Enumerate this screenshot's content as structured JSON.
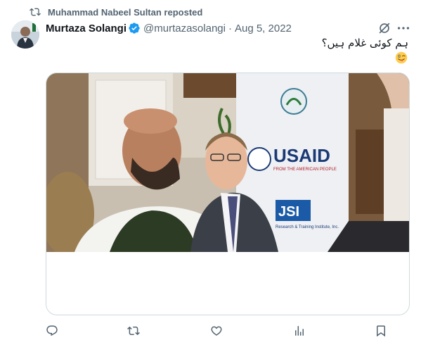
{
  "repost": {
    "text": "Muhammad Nabeel Sultan reposted",
    "icon": "repost-icon"
  },
  "author": {
    "name": "Murtaza Solangi",
    "handle": "@murtazasolangi",
    "separator": "·",
    "date": "Aug 5, 2022",
    "verified": true
  },
  "tweet": {
    "text": "ہم کوئی غلام ہیں؟",
    "emoji": "😜"
  },
  "media": {
    "sign_text": "USAID",
    "sign_subtext": "FROM THE AMERICAN PEOPLE",
    "jsi_text": "JSI",
    "jsi_subtext": "Research & Training Institute, Inc."
  },
  "actions": [
    {
      "name": "reply",
      "icon": "reply-icon"
    },
    {
      "name": "repost",
      "icon": "repost-icon"
    },
    {
      "name": "like",
      "icon": "heart-icon"
    },
    {
      "name": "views",
      "icon": "views-icon"
    },
    {
      "name": "bookmark",
      "icon": "bookmark-icon"
    }
  ],
  "colors": {
    "accent": "#1d9bf0",
    "muted": "#536471",
    "text": "#0f1419",
    "border": "#cfd9de"
  }
}
